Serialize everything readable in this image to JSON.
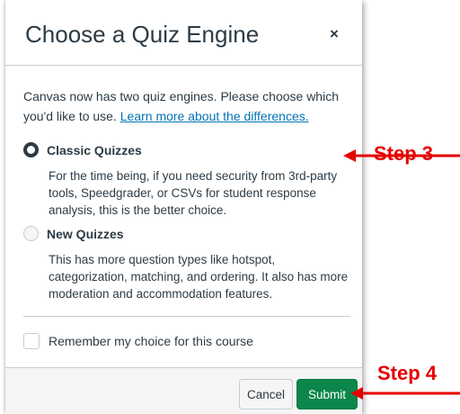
{
  "modal": {
    "title": "Choose a Quiz Engine",
    "close_label": "×",
    "intro_text": "Canvas now has two quiz engines. Please choose which you'd like to use.",
    "learn_more_link": "Learn more about the differences.",
    "options": [
      {
        "label": "Classic Quizzes",
        "selected": true,
        "description": "For the time being, if you need security from 3rd-party tools, Speedgrader, or CSVs for student response analysis, this is the better choice."
      },
      {
        "label": "New Quizzes",
        "selected": false,
        "description": "This has more question types like hotspot, categorization, matching, and ordering. It also has more moderation and accommodation features."
      }
    ],
    "remember_choice_label": "Remember my choice for this course",
    "remember_choice_checked": false,
    "cancel_label": "Cancel",
    "submit_label": "Submit"
  },
  "annotations": {
    "step3_label": "Step 3",
    "step4_label": "Step 4",
    "color": "#e60000"
  },
  "colors": {
    "submit_bg": "#0b874b",
    "link": "#0374b5",
    "text": "#2d3b45"
  }
}
